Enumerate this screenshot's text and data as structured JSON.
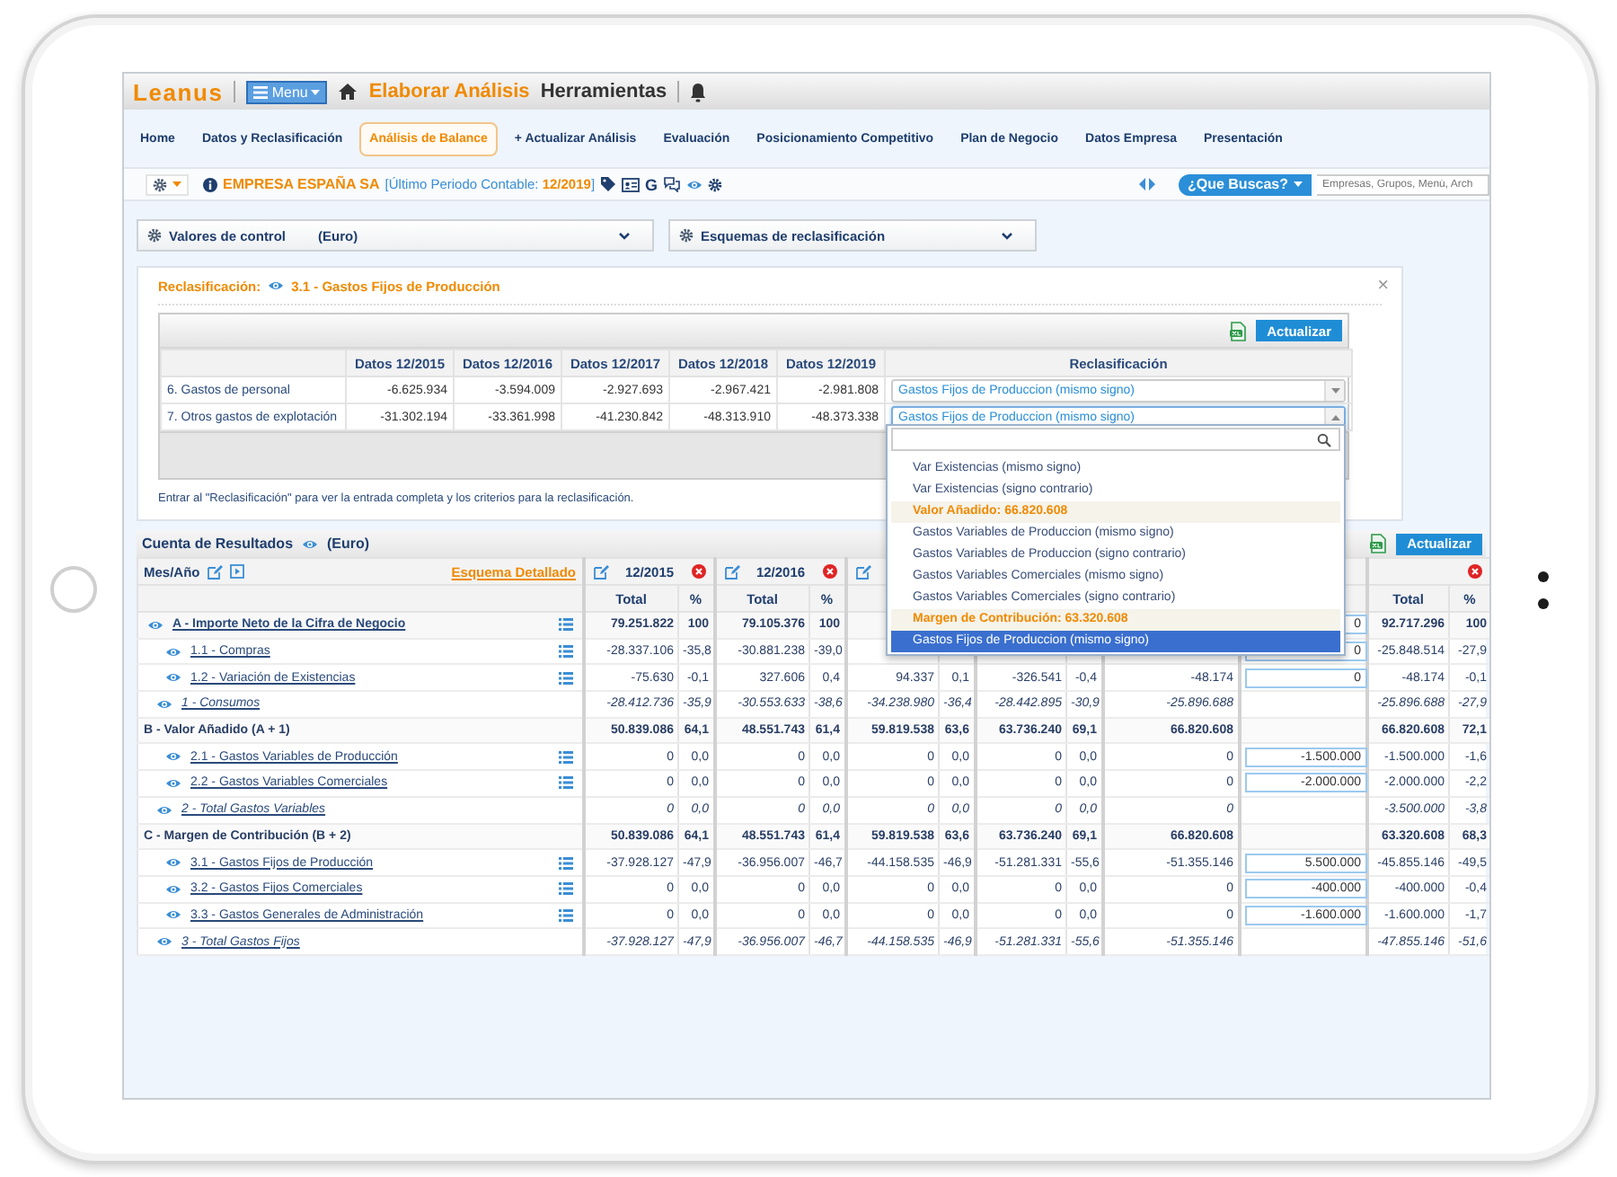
{
  "topbar": {
    "logo": "Leanus",
    "menu": "Menu",
    "primary": "Elaborar Análisis",
    "secondary": "Herramientas"
  },
  "nav": [
    {
      "label": "Home",
      "selected": false
    },
    {
      "label": "Datos y Reclasificación",
      "selected": false
    },
    {
      "label": "Análisis de Balance",
      "selected": true
    },
    {
      "label": "+ Actualizar Análisis",
      "selected": false
    },
    {
      "label": "Evaluación",
      "selected": false
    },
    {
      "label": "Posicionamiento Competitivo",
      "selected": false
    },
    {
      "label": "Plan de Negocio",
      "selected": false
    },
    {
      "label": "Datos Empresa",
      "selected": false
    },
    {
      "label": "Presentación",
      "selected": false
    }
  ],
  "company": {
    "name": "EMPRESA ESPAÑA SA",
    "period": "[Último Periodo Contable: **12/2019**]",
    "glyph": "G",
    "search_button": "¿Que Buscas?",
    "search_placeholder": "Empresas, Grupos, Menú, Arch"
  },
  "selectors": [
    {
      "label": "Valores de control",
      "unit": "(Euro)"
    },
    {
      "label": "Esquemas de reclasificación"
    }
  ],
  "reclass": {
    "title": "Reclasificación:",
    "account": "3.1 - Gastos Fijos de Producción",
    "close": "×",
    "button": "Actualizar",
    "columns": [
      "Datos 12/2015",
      "Datos 12/2016",
      "Datos 12/2017",
      "Datos 12/2018",
      "Datos 12/2019",
      "Reclasificación"
    ],
    "rows": [
      {
        "label": "6. Gastos de personal",
        "values": [
          "-6.625.934",
          "-3.594.009",
          "-2.927.693",
          "-2.967.421",
          "-2.981.808"
        ],
        "reclass": "Gastos Fijos de Produccion (mismo signo)",
        "open": false
      },
      {
        "label": "7. Otros gastos de explotación",
        "values": [
          "-31.302.194",
          "-33.361.998",
          "-41.230.842",
          "-48.313.910",
          "-48.373.338"
        ],
        "reclass": "Gastos Fijos de Produccion (mismo signo)",
        "open": true
      }
    ],
    "note": "Entrar al \"Reclasificación\" para ver la entrada completa y los criterios para la reclasificación.",
    "dropdown": {
      "options": [
        {
          "kind": "option",
          "label": "Var Existencias (mismo signo)",
          "selected": false
        },
        {
          "kind": "option",
          "label": "Var Existencias (signo contrario)",
          "selected": false
        },
        {
          "kind": "group",
          "label": "Valor Añadido: 66.820.608",
          "selected": false
        },
        {
          "kind": "option",
          "label": "Gastos Variables de Produccion (mismo signo)",
          "selected": false
        },
        {
          "kind": "option",
          "label": "Gastos Variables de Produccion (signo contrario)",
          "selected": false
        },
        {
          "kind": "option",
          "label": "Gastos Variables Comerciales (mismo signo)",
          "selected": false
        },
        {
          "kind": "option",
          "label": "Gastos Variables Comerciales (signo contrario)",
          "selected": false
        },
        {
          "kind": "group",
          "label": "Margen de Contribución: 63.320.608",
          "selected": false
        },
        {
          "kind": "option",
          "label": "Gastos Fijos de Produccion (mismo signo)",
          "selected": true
        }
      ]
    }
  },
  "results": {
    "title": "Cuenta de Resultados",
    "unit": "(Euro)",
    "button": "Actualizar",
    "period_heading": "Mes/Año",
    "scheme_link": "Esquema Detallado",
    "periods": [
      "12/2015",
      "12/2016"
    ],
    "subheaders_left": [
      "Total",
      "%",
      "Total",
      "%"
    ],
    "subheaders_right": [
      "Total",
      "%"
    ],
    "rows": [
      {
        "kind": "heading",
        "label": "A - Importe Neto de la Cifra de Negocio",
        "cells": [
          "79.251.822",
          "100",
          "79.105.376",
          "100",
          null,
          null,
          null,
          null,
          null,
          "92.717.296",
          "100"
        ],
        "adjustment": "0"
      },
      {
        "kind": "item",
        "label": "1.1 - Compras",
        "cells": [
          "-28.337.106",
          "-35,8",
          "-30.881.238",
          "-39,0",
          null,
          null,
          null,
          null,
          null,
          "-25.848.514",
          "-27,9"
        ],
        "adjustment": "0"
      },
      {
        "kind": "item",
        "label": "1.2 - Variación de Existencias",
        "cells": [
          "-75.630",
          "-0,1",
          "327.606",
          "0,4",
          "94.337",
          "0,1",
          "-326.541",
          "-0,4",
          "-48.174",
          "-48.174",
          "-0,1"
        ],
        "adjustment": "0"
      },
      {
        "kind": "subtotal",
        "label": "1 - Consumos",
        "cells": [
          "-28.412.736",
          "-35,9",
          "-30.553.633",
          "-38,6",
          "-34.238.980",
          "-36,4",
          "-28.442.895",
          "-30,9",
          "-25.896.688",
          "-25.896.688",
          "-27,9"
        ]
      },
      {
        "kind": "total",
        "label": "B - Valor Añadido (A + 1)",
        "cells": [
          "50.839.086",
          "64,1",
          "48.551.743",
          "61,4",
          "59.819.538",
          "63,6",
          "63.736.240",
          "69,1",
          "66.820.608",
          "66.820.608",
          "72,1"
        ]
      },
      {
        "kind": "item",
        "label": "2.1 - Gastos Variables de Producción",
        "cells": [
          "0",
          "0,0",
          "0",
          "0,0",
          "0",
          "0,0",
          "0",
          "0,0",
          "0",
          "-1.500.000",
          "-1,6"
        ],
        "adjustment": "-1.500.000"
      },
      {
        "kind": "item",
        "label": "2.2 - Gastos Variables Comerciales",
        "cells": [
          "0",
          "0,0",
          "0",
          "0,0",
          "0",
          "0,0",
          "0",
          "0,0",
          "0",
          "-2.000.000",
          "-2,2"
        ],
        "adjustment": "-2.000.000"
      },
      {
        "kind": "subtotal",
        "label": "2 - Total Gastos Variables",
        "cells": [
          "0",
          "0,0",
          "0",
          "0,0",
          "0",
          "0,0",
          "0",
          "0,0",
          "0",
          "-3.500.000",
          "-3,8"
        ]
      },
      {
        "kind": "total",
        "label": "C - Margen de Contribución (B + 2)",
        "cells": [
          "50.839.086",
          "64,1",
          "48.551.743",
          "61,4",
          "59.819.538",
          "63,6",
          "63.736.240",
          "69,1",
          "66.820.608",
          "63.320.608",
          "68,3"
        ]
      },
      {
        "kind": "item",
        "label": "3.1 - Gastos Fijos de Producción",
        "cells": [
          "-37.928.127",
          "-47,9",
          "-36.956.007",
          "-46,7",
          "-44.158.535",
          "-46,9",
          "-51.281.331",
          "-55,6",
          "-51.355.146",
          "-45.855.146",
          "-49,5"
        ],
        "adjustment": "5.500.000"
      },
      {
        "kind": "item",
        "label": "3.2 - Gastos Fijos Comerciales",
        "cells": [
          "0",
          "0,0",
          "0",
          "0,0",
          "0",
          "0,0",
          "0",
          "0,0",
          "0",
          "-400.000",
          "-0,4"
        ],
        "adjustment": "-400.000"
      },
      {
        "kind": "item",
        "label": "3.3 - Gastos Generales de Administración",
        "cells": [
          "0",
          "0,0",
          "0",
          "0,0",
          "0",
          "0,0",
          "0",
          "0,0",
          "0",
          "-1.600.000",
          "-1,7"
        ],
        "adjustment": "-1.600.000"
      },
      {
        "kind": "subtotal",
        "label": "3 - Total Gastos Fijos",
        "cells": [
          "-37.928.127",
          "-47,9",
          "-36.956.007",
          "-46,7",
          "-44.158.535",
          "-46,9",
          "-51.281.331",
          "-55,6",
          "-51.355.146",
          "-47.855.146",
          "-51,6"
        ]
      }
    ]
  }
}
